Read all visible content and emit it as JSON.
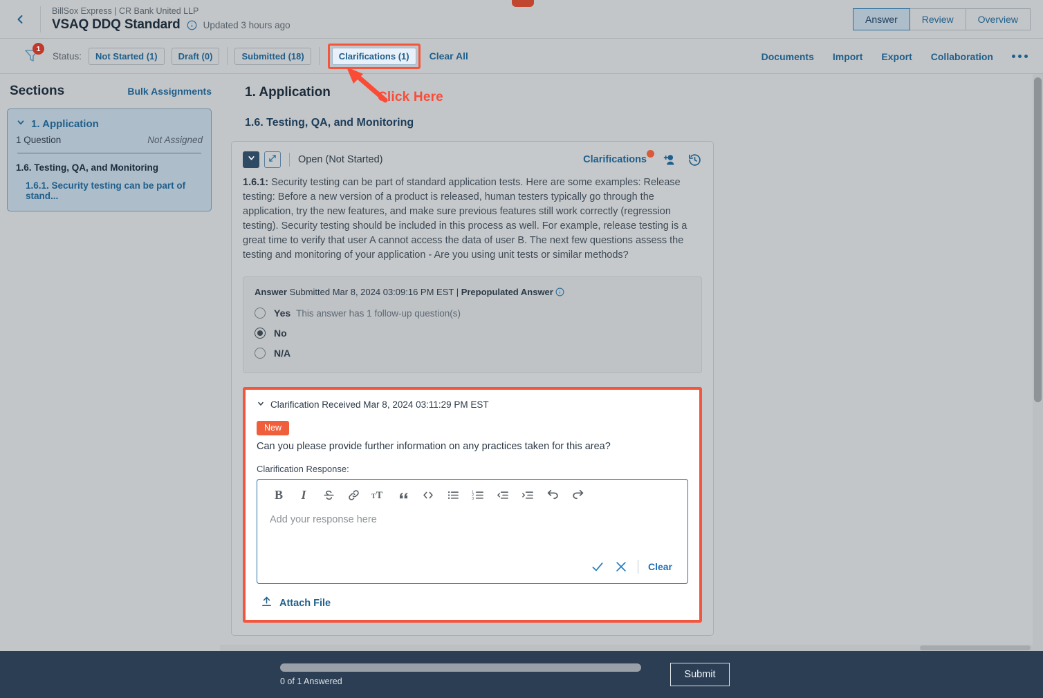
{
  "topbar": {
    "back_icon": "chevron-left-icon",
    "breadcrumb": "BillSox Express | CR Bank United LLP",
    "doc_title": "VSAQ DDQ Standard",
    "info_icon": "info-icon",
    "updated": "Updated 3 hours ago",
    "views": [
      {
        "label": "Answer",
        "active": true
      },
      {
        "label": "Review",
        "active": false
      },
      {
        "label": "Overview",
        "active": false
      }
    ]
  },
  "filterbar": {
    "filter_icon": "filter-icon",
    "filter_badge": "1",
    "status_label": "Status:",
    "chips": [
      {
        "label": "Not Started (1)"
      },
      {
        "label": "Draft (0)"
      },
      {
        "label": "Submitted (18)"
      }
    ],
    "highlighted_chip": {
      "label": "Clarifications (1)"
    },
    "clear_all": "Clear All",
    "links": [
      "Documents",
      "Import",
      "Export",
      "Collaboration"
    ],
    "more_icon": "more-horizontal-icon"
  },
  "sidebar": {
    "title": "Sections",
    "bulk_assignments": "Bulk Assignments",
    "section": {
      "chevron_icon": "chevron-down-icon",
      "name": "1. Application",
      "question_count": "1 Question",
      "assignment": "Not Assigned",
      "subsection": "1.6. Testing, QA, and Monitoring",
      "question_link": "1.6.1. Security testing can be part of stand..."
    }
  },
  "main": {
    "section_title": "1. Application",
    "subsection_title": "1.6. Testing, QA, and Monitoring",
    "question_card": {
      "collapse_icon": "chevron-down-icon",
      "expand_icon": "expand-diagonal-icon",
      "status": "Open (Not Started)",
      "clarifications_link": "Clarifications",
      "clarifications_dot": "unread-dot-icon",
      "assign_icon": "add-person-icon",
      "history_icon": "history-clock-icon",
      "question_number": "1.6.1:",
      "question_text": " Security testing can be part of standard application tests. Here are some examples: Release testing: Before a new version of a product is released, human testers typically go through the application, try the new features, and make sure previous features still work correctly (regression testing). Security testing should be included in this process as well. For example, release testing is a great time to verify that user A cannot access the data of user B. The next few questions assess the testing and monitoring of your application - Are you using unit tests or similar methods?"
    },
    "answer": {
      "meta_label": "Answer",
      "meta_submitted": " Submitted Mar 8, 2024 03:09:16 PM EST | ",
      "meta_prepopulated": "Prepopulated Answer",
      "info_icon": "info-icon",
      "options": [
        {
          "label": "Yes",
          "note": "This answer has 1 follow-up question(s)",
          "checked": false
        },
        {
          "label": "No",
          "note": "",
          "checked": true
        },
        {
          "label": "N/A",
          "note": "",
          "checked": false
        }
      ]
    },
    "clarification": {
      "chevron_icon": "chevron-down-icon",
      "received_header": "Clarification Received Mar 8, 2024 03:11:29 PM EST",
      "badge": "New",
      "question": "Can you please provide further information on any practices taken for this area?",
      "response_label": "Clarification Response:",
      "editor": {
        "placeholder": "Add your response here",
        "tools": [
          {
            "icon": "bold-icon",
            "glyph": "B"
          },
          {
            "icon": "italic-icon",
            "glyph": "I"
          },
          {
            "icon": "strikethrough-icon",
            "glyph": "S"
          },
          {
            "icon": "link-icon",
            "glyph": "ὑ7"
          },
          {
            "icon": "font-size-icon",
            "glyph": "TT"
          },
          {
            "icon": "blockquote-icon",
            "glyph": "”"
          },
          {
            "icon": "code-block-icon",
            "glyph": "<>"
          },
          {
            "icon": "bulleted-list-icon",
            "glyph": "•"
          },
          {
            "icon": "numbered-list-icon",
            "glyph": "1."
          },
          {
            "icon": "outdent-icon",
            "glyph": "‹"
          },
          {
            "icon": "indent-icon",
            "glyph": "›"
          },
          {
            "icon": "undo-icon",
            "glyph": "↶"
          },
          {
            "icon": "redo-icon",
            "glyph": "↷"
          }
        ],
        "confirm_icon": "check-icon",
        "cancel_icon": "close-x-icon",
        "clear_label": "Clear"
      },
      "attach_icon": "upload-icon",
      "attach_label": "Attach File"
    }
  },
  "bottombar": {
    "progress_text": "0 of 1 Answered",
    "progress_percent": 0,
    "submit_label": "Submit"
  },
  "annotation": {
    "text": "Click Here",
    "color": "#fa4b37"
  },
  "colors": {
    "page_bg": "#c3c6c8",
    "accent_blue": "#1f5f8b",
    "highlight_red": "#f4553d",
    "badge_orange": "#ef5f3c",
    "bottom_bar": "#2b3e53"
  }
}
